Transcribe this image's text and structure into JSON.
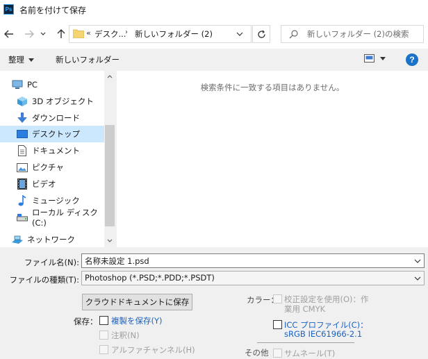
{
  "window": {
    "title": "名前を付けて保存",
    "app_logo": "Ps"
  },
  "nav": {
    "address_overflow": "«",
    "address_segments": [
      "デスク...",
      "新しいフォルダー (2)"
    ],
    "address_separator": "›",
    "search_placeholder": "新しいフォルダー (2)の検索"
  },
  "toolbar": {
    "organize_label": "整理",
    "new_folder_label": "新しいフォルダー"
  },
  "tree": {
    "items": [
      {
        "label": "PC",
        "icon": "pc-icon"
      },
      {
        "label": "3D オブジェクト",
        "icon": "3d-objects-icon"
      },
      {
        "label": "ダウンロード",
        "icon": "download-icon"
      },
      {
        "label": "デスクトップ",
        "icon": "desktop-icon",
        "selected": true
      },
      {
        "label": "ドキュメント",
        "icon": "document-icon"
      },
      {
        "label": "ピクチャ",
        "icon": "pictures-icon"
      },
      {
        "label": "ビデオ",
        "icon": "video-icon"
      },
      {
        "label": "ミュージック",
        "icon": "music-icon"
      },
      {
        "label": "ローカル ディスク (C:)",
        "icon": "local-disk-icon"
      },
      {
        "label": "ネットワーク",
        "icon": "network-icon"
      }
    ]
  },
  "file_list": {
    "empty_message": "検索条件に一致する項目はありません。"
  },
  "form": {
    "filename_label": "ファイル名(N):",
    "filename_value": "名称未設定 1.psd",
    "filetype_label": "ファイルの種類(T):",
    "filetype_value": "Photoshop (*.PSD;*.PDD;*.PSDT)",
    "cloud_button": "クラウドドキュメントに保存",
    "save_label": "保存：",
    "save_copy": "複製を保存(Y)",
    "notes": "注釈(N)",
    "alpha_channels": "アルファチャンネル(H)",
    "color_label": "カラー：",
    "proof_setup_line1": "校正設定を使用(O)：作",
    "proof_setup_line2": "業用 CMYK",
    "icc_line1": "ICC プロファイル(C)：",
    "icc_line2": "sRGB IEC61966-2.1",
    "other_label": "その他",
    "thumbnail": "サムネール(T)"
  },
  "colors": {
    "accent": "#1a73c8",
    "selection": "#cce8ff",
    "link": "#1a61c0"
  }
}
